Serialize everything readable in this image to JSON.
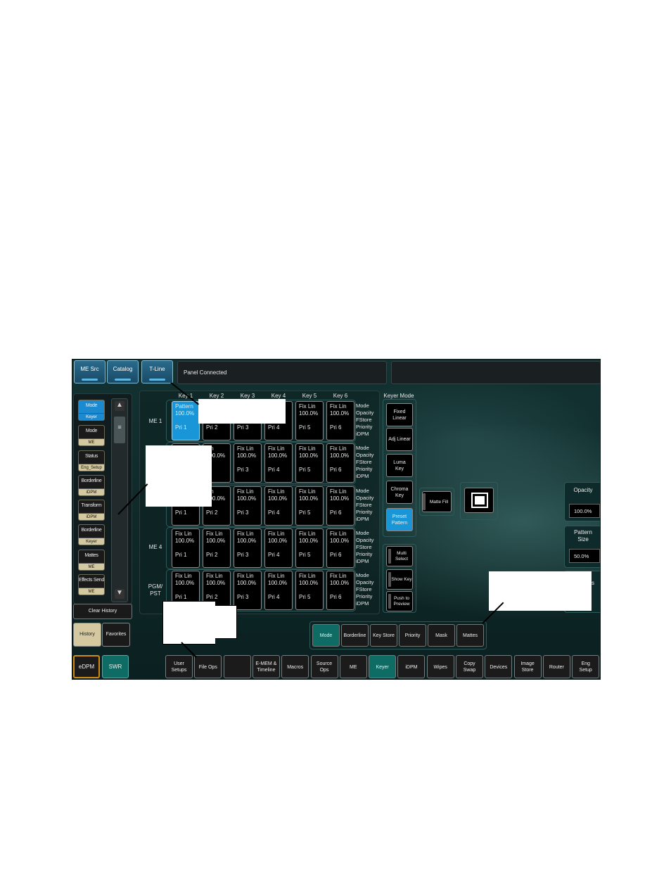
{
  "top_bar": {
    "buttons": [
      "ME Src",
      "Catalog",
      "T-Line"
    ],
    "status": "Panel Connected"
  },
  "history_panel": {
    "items": [
      {
        "label": "Mode",
        "sub": "Keyer",
        "selected": true
      },
      {
        "label": "Mode",
        "sub": "ME",
        "selected": false
      },
      {
        "label": "Status",
        "sub": "Eng_Setup",
        "selected": false
      },
      {
        "label": "Borderline",
        "sub": "iDPM",
        "selected": false
      },
      {
        "label": "Transform",
        "sub": "iDPM",
        "selected": false
      },
      {
        "label": "Borderline",
        "sub": "Keyer",
        "selected": false
      },
      {
        "label": "Mattes",
        "sub": "ME",
        "selected": false
      },
      {
        "label": "Effects Send",
        "sub": "ME",
        "selected": false
      }
    ],
    "clear_label": "Clear History",
    "tabs": [
      "History",
      "Favorites"
    ]
  },
  "keyer_grid": {
    "columns": [
      "Key 1",
      "Key 2",
      "Key 3",
      "Key 4",
      "Key 5",
      "Key 6"
    ],
    "row_labels": [
      "ME 1",
      "",
      "",
      "ME 4",
      "PGM/\nPST"
    ],
    "info_lines": [
      "Mode",
      "Opacity",
      "FStore",
      "Priority",
      "iDPM"
    ],
    "rows": [
      [
        {
          "mode": "Pattern",
          "opacity": "100.0%",
          "pri": "Pri 1",
          "selected": true
        },
        {
          "mode": "",
          "opacity": "",
          "pri": "Pri 2"
        },
        {
          "mode": "",
          "opacity": "",
          "pri": "Pri 3"
        },
        {
          "mode": "",
          "opacity": "",
          "pri": "Pri 4"
        },
        {
          "mode": "Fix Lin",
          "opacity": "100.0%",
          "pri": "Pri 5"
        },
        {
          "mode": "Fix Lin",
          "opacity": "100.0%",
          "pri": "Pri 6"
        }
      ],
      [
        {
          "mode": "",
          "opacity": "",
          "pri": ""
        },
        {
          "mode": "Lin",
          "opacity": "100.0%",
          "pri": "2"
        },
        {
          "mode": "Fix Lin",
          "opacity": "100.0%",
          "pri": "Pri 3"
        },
        {
          "mode": "Fix Lin",
          "opacity": "100.0%",
          "pri": "Pri 4"
        },
        {
          "mode": "Fix Lin",
          "opacity": "100.0%",
          "pri": "Pri 5"
        },
        {
          "mode": "Fix Lin",
          "opacity": "100.0%",
          "pri": "Pri 6"
        }
      ],
      [
        {
          "mode": "",
          "opacity": "",
          "pri": "Pri 1"
        },
        {
          "mode": "Lin",
          "opacity": "100.0%",
          "pri": "Pri 2"
        },
        {
          "mode": "Fix Lin",
          "opacity": "100.0%",
          "pri": "Pri 3"
        },
        {
          "mode": "Fix Lin",
          "opacity": "100.0%",
          "pri": "Pri 4"
        },
        {
          "mode": "Fix Lin",
          "opacity": "100.0%",
          "pri": "Pri 5"
        },
        {
          "mode": "Fix Lin",
          "opacity": "100.0%",
          "pri": "Pri 6"
        }
      ],
      [
        {
          "mode": "Fix Lin",
          "opacity": "100.0%",
          "pri": "Pri 1"
        },
        {
          "mode": "Fix Lin",
          "opacity": "100.0%",
          "pri": "Pri 2"
        },
        {
          "mode": "Fix Lin",
          "opacity": "100.0%",
          "pri": "Pri 3"
        },
        {
          "mode": "Fix Lin",
          "opacity": "100.0%",
          "pri": "Pri 4"
        },
        {
          "mode": "Fix Lin",
          "opacity": "100.0%",
          "pri": "Pri 5"
        },
        {
          "mode": "Fix Lin",
          "opacity": "100.0%",
          "pri": "Pri 6"
        }
      ],
      [
        {
          "mode": "Fix Lin",
          "opacity": "100.0%",
          "pri": "Pri 1"
        },
        {
          "mode": "Fix Lin",
          "opacity": "100.0%",
          "pri": "Pri 2"
        },
        {
          "mode": "Fix Lin",
          "opacity": "100.0%",
          "pri": "Pri 3"
        },
        {
          "mode": "Fix Lin",
          "opacity": "100.0%",
          "pri": "Pri 4"
        },
        {
          "mode": "Fix Lin",
          "opacity": "100.0%",
          "pri": "Pri 5"
        },
        {
          "mode": "Fix Lin",
          "opacity": "100.0%",
          "pri": "Pri 6"
        }
      ]
    ]
  },
  "keyer_mode": {
    "title": "Keyer Mode",
    "modes": [
      "Fixed\nLinear",
      "Adj Linear",
      "Luma\nKey",
      "Chroma\nKey",
      "Preset\nPattern"
    ],
    "selected": "Preset\nPattern",
    "actions": [
      "Multi\nSelect",
      "Show Key",
      "Push to\nPreview"
    ]
  },
  "pattern_controls": {
    "matte_fill_label": "Matte Fill",
    "opacity_label": "Opacity",
    "opacity_value": "100.0%",
    "pattern_size_label": "Pattern\nSize",
    "pattern_size_value": "50.0%",
    "partial_label": "ss"
  },
  "sub_tabs": {
    "items": [
      "Mode",
      "Borderline",
      "Key Store",
      "Priority",
      "Mask",
      "Mattes"
    ],
    "selected": "Mode"
  },
  "bottom_nav": {
    "left": [
      "eDPM",
      "SWR"
    ],
    "items": [
      "User\nSetups",
      "File Ops",
      "",
      "E-MEM &\nTimeline",
      "Macros",
      "Source\nOps",
      "ME",
      "Keyer",
      "iDPM",
      "Wipes",
      "Copy\nSwap",
      "Devices",
      "Image\nStore",
      "Router",
      "Eng\nSetup"
    ],
    "selected": "Keyer"
  },
  "colors": {
    "selected_blue": "#1896d8",
    "selected_teal": "#0f6c64",
    "history_tan": "#d3c8a0",
    "background": "#0d2626"
  }
}
